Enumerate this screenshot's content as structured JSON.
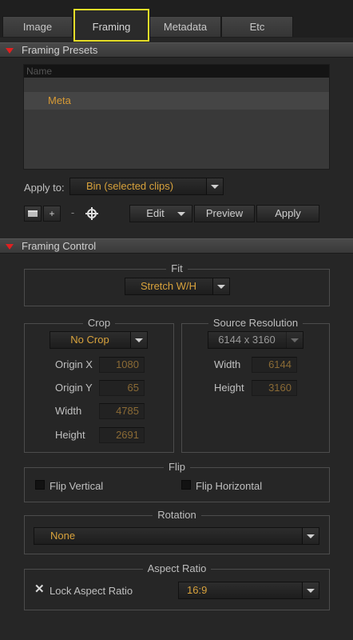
{
  "tabs": [
    {
      "label": "Image"
    },
    {
      "label": "Framing"
    },
    {
      "label": "Metadata"
    },
    {
      "label": "Etc"
    }
  ],
  "presets": {
    "header": "Framing Presets",
    "list_column": "Name",
    "items": [
      "Meta"
    ],
    "apply_to_label": "Apply to:",
    "apply_to_value": "Bin (selected clips)",
    "icon_add": "+",
    "icon_remove": "-",
    "edit_label": "Edit",
    "preview_label": "Preview",
    "apply_label": "Apply"
  },
  "control": {
    "header": "Framing Control",
    "fit": {
      "title": "Fit",
      "value": "Stretch W/H"
    },
    "crop": {
      "title": "Crop",
      "mode": "No Crop",
      "origin_x_label": "Origin X",
      "origin_x": "1080",
      "origin_y_label": "Origin Y",
      "origin_y": "65",
      "width_label": "Width",
      "width": "4785",
      "height_label": "Height",
      "height": "2691"
    },
    "source": {
      "title": "Source Resolution",
      "resolution": "6144 x 3160",
      "width_label": "Width",
      "width": "6144",
      "height_label": "Height",
      "height": "3160"
    },
    "flip": {
      "title": "Flip",
      "vertical_label": "Flip Vertical",
      "vertical_checked": false,
      "horizontal_label": "Flip Horizontal",
      "horizontal_checked": false
    },
    "rotation": {
      "title": "Rotation",
      "value": "None"
    },
    "aspect": {
      "title": "Aspect Ratio",
      "lock_label": "Lock Aspect Ratio",
      "lock_checked": true,
      "value": "16:9"
    }
  },
  "colors": {
    "accent": "#d8a23c",
    "tab_highlight": "#e6de28",
    "section_triangle": "#e02020"
  }
}
